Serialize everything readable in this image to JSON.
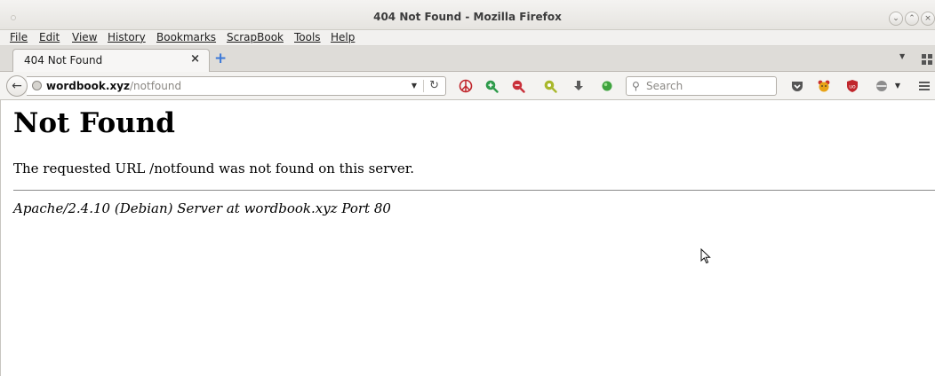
{
  "window": {
    "title": "404 Not Found - Mozilla Firefox"
  },
  "menu": [
    "File",
    "Edit",
    "View",
    "History",
    "Bookmarks",
    "ScrapBook",
    "Tools",
    "Help"
  ],
  "tab": {
    "label": "404 Not Found",
    "close": "×",
    "new_tab": "+"
  },
  "urlbar": {
    "host": "wordbook.xyz",
    "path": "/notfound"
  },
  "search": {
    "placeholder": "Search"
  },
  "page": {
    "heading": "Not Found",
    "message": "The requested URL /notfound was not found on this server.",
    "signature": "Apache/2.4.10 (Debian) Server at wordbook.xyz Port 80"
  },
  "colors": {
    "accent": "#3b78d8",
    "ublock": "#c0262c",
    "green": "#3fa33f"
  },
  "icons": [
    "back-icon",
    "globe-icon",
    "reload-icon",
    "peace-icon",
    "zoom-in-icon",
    "zoom-out-icon",
    "zoom-reset-icon",
    "download-icon",
    "green-dot-icon",
    "pocket-icon",
    "bear-icon",
    "ublock-icon",
    "addon-icon",
    "hamburger-icon"
  ]
}
